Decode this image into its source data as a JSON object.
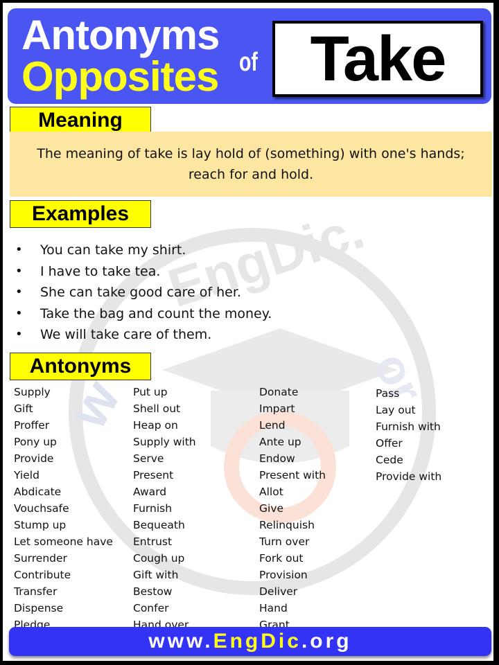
{
  "header": {
    "line1": "Antonyms",
    "line2": "Opposites",
    "connector": "of",
    "word": "Take"
  },
  "meaning": {
    "label": "Meaning",
    "text": "The meaning of take is lay hold of (something) with one's hands; reach for and hold."
  },
  "examples": {
    "label": "Examples",
    "bullet": "•",
    "items": [
      "You can take my shirt.",
      "I have to take tea.",
      "She can take good care of her.",
      "Take the bag and count the money.",
      "We will take care of them."
    ]
  },
  "antonyms": {
    "label": "Antonyms",
    "columns": [
      [
        "Supply",
        "Gift",
        "Proffer",
        "Pony up",
        "Provide",
        "Yield",
        "Abdicate",
        "Vouchsafe",
        "Stump up",
        "Let someone have",
        "Surrender",
        "Contribute",
        "Transfer",
        "Dispense",
        "Pledge"
      ],
      [
        "Put up",
        "Shell out",
        "Heap on",
        "Supply with",
        "Serve",
        "Present",
        "Award",
        "Furnish",
        "Bequeath",
        "Entrust",
        "Cough up",
        "Gift with",
        "Bestow",
        "Confer",
        "Hand over"
      ],
      [
        "Donate",
        "Impart",
        "Lend",
        "Ante up",
        "Endow",
        "Present with",
        "Allot",
        "Give",
        "Relinquish",
        "Turn over",
        "Fork out",
        "Provision",
        "Deliver",
        "Hand",
        "Grant"
      ],
      [
        "Pass",
        "Lay out",
        "Furnish with",
        "Offer",
        "Cede",
        "Provide with"
      ]
    ]
  },
  "footer": {
    "prefix": "www.",
    "highlight": "EngDic",
    "suffix": ".org"
  },
  "watermark": {
    "text": "www.EngDic.org",
    "icon": "graduation-cap-e-logo"
  },
  "colors": {
    "banner_blue": "#4a55f2",
    "footer_blue": "#3333f5",
    "accent_yellow": "#ffff00",
    "meaning_bg": "#fde6a2"
  }
}
